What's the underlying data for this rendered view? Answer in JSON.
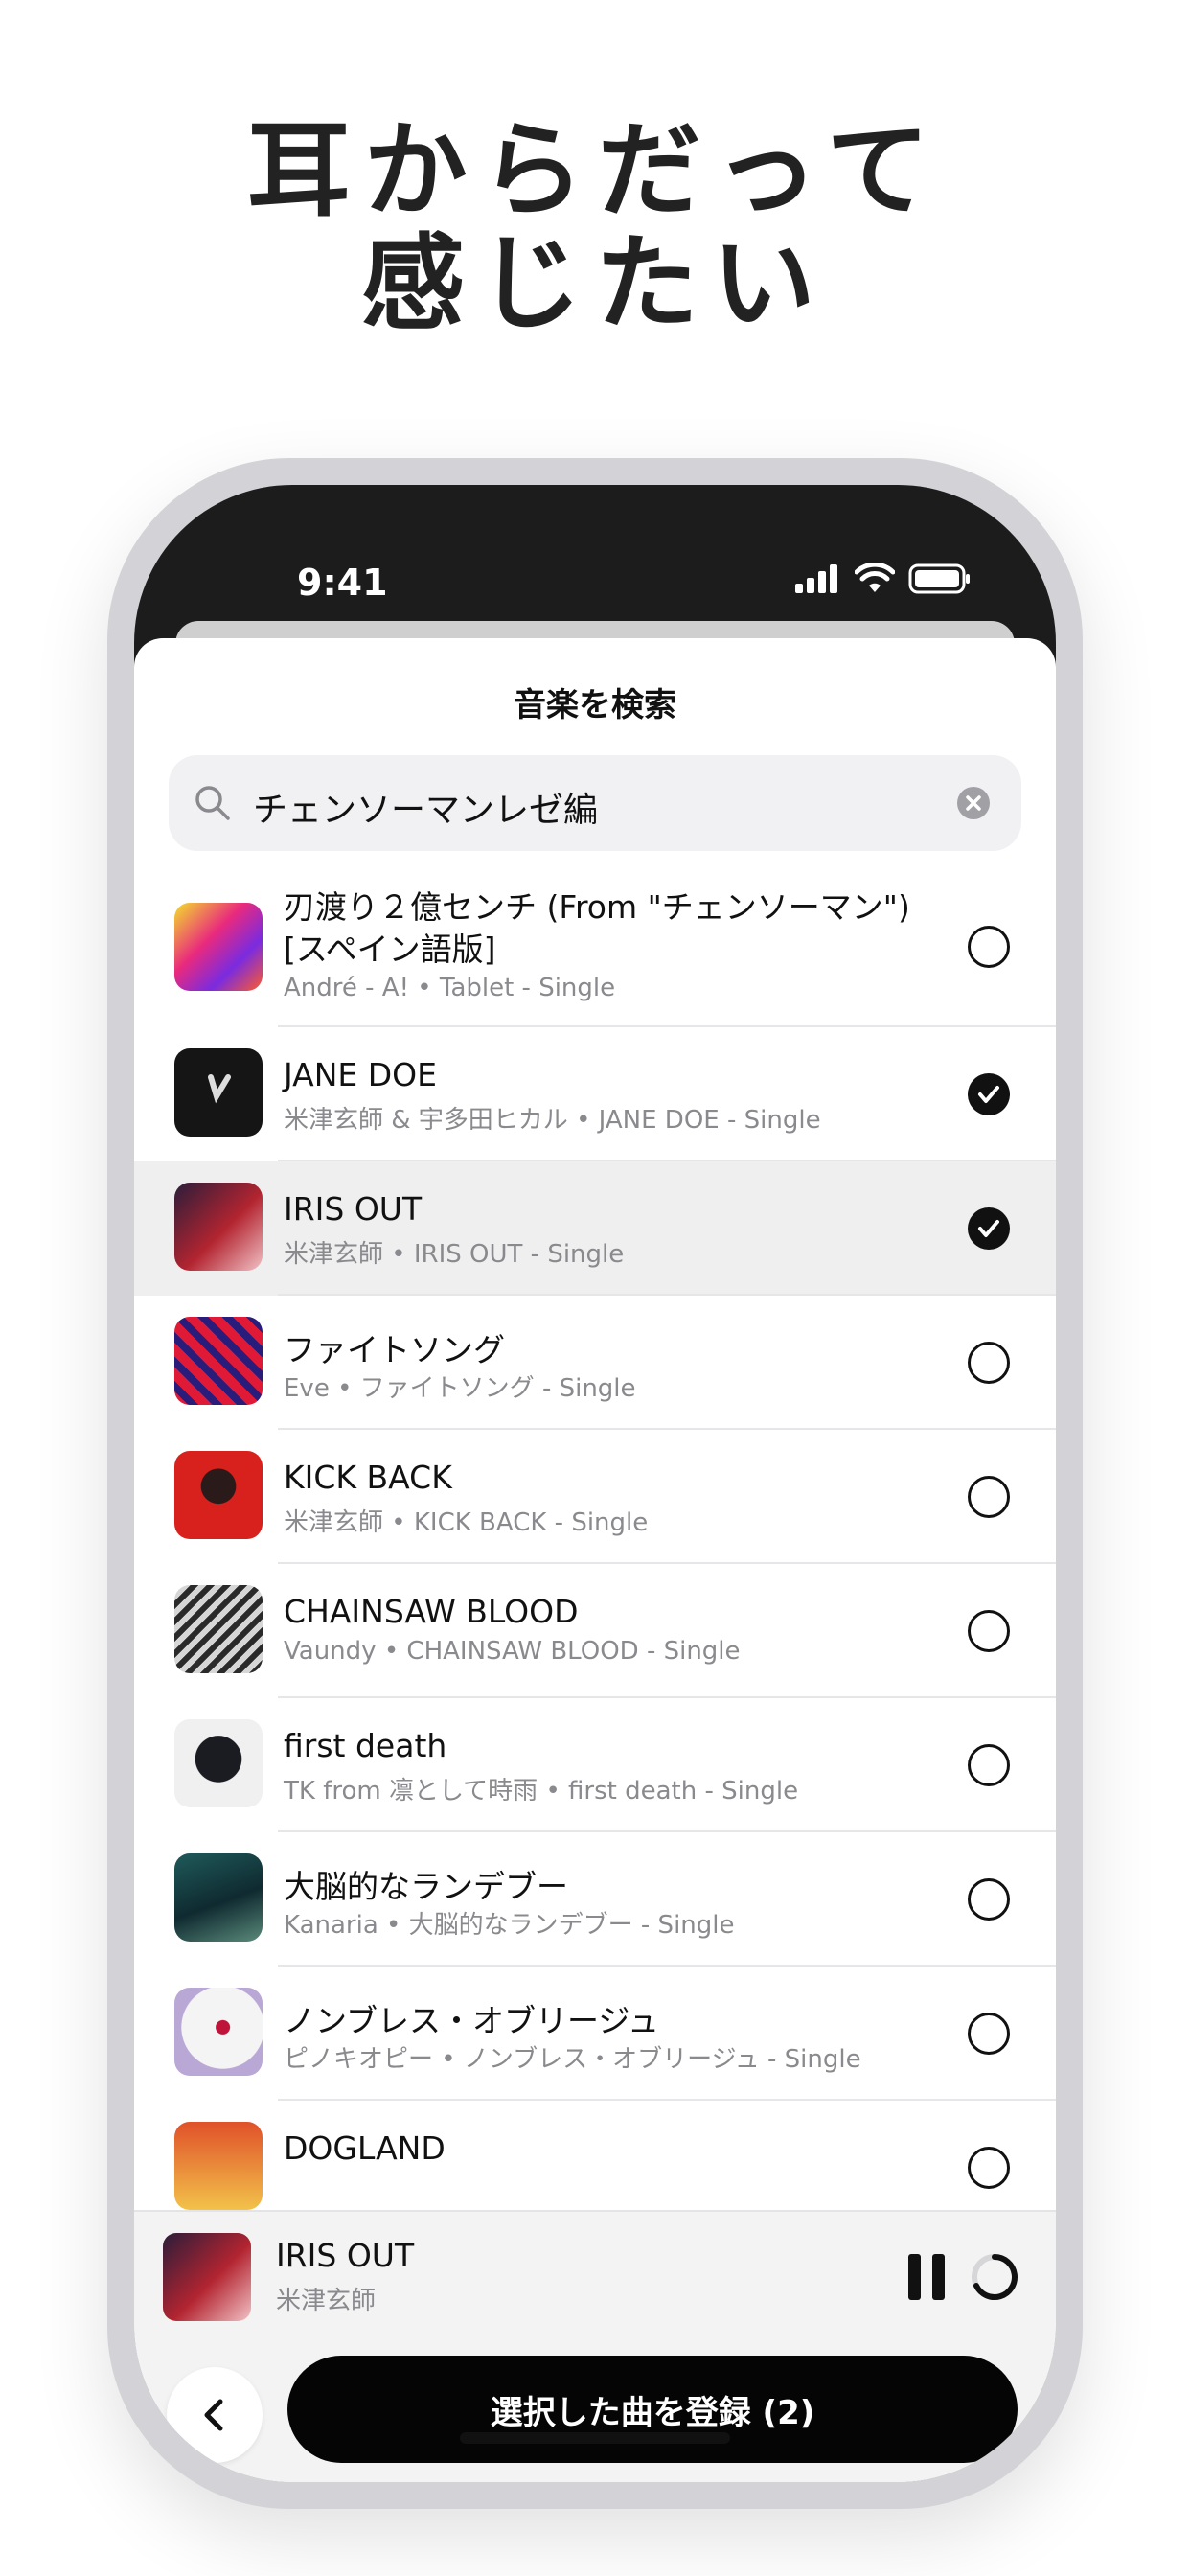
{
  "headline": {
    "line1": "耳からだって",
    "line2": "感じたい"
  },
  "status_bar": {
    "time": "9:41"
  },
  "sheet": {
    "title": "音楽を検索",
    "search": {
      "value": "チェンソーマンレゼ編"
    }
  },
  "tracks": [
    {
      "title_line1": "刃渡り２億センチ (From \"チェンソーマン\")",
      "title_line2": "[スペイン語版]",
      "subtitle": "André - A! • Tablet - Single",
      "selected": false
    },
    {
      "title": "JANE DOE",
      "subtitle": "米津玄師 & 宇多田ヒカル • JANE DOE - Single",
      "selected": true
    },
    {
      "title": "IRIS OUT",
      "subtitle": "米津玄師 • IRIS OUT - Single",
      "selected": true
    },
    {
      "title": "ファイトソング",
      "subtitle": "Eve • ファイトソング - Single",
      "selected": false
    },
    {
      "title": "KICK BACK",
      "subtitle": "米津玄師 • KICK BACK - Single",
      "selected": false
    },
    {
      "title": "CHAINSAW BLOOD",
      "subtitle": "Vaundy • CHAINSAW BLOOD - Single",
      "selected": false
    },
    {
      "title": "first death",
      "subtitle": "TK from 凛として時雨 • first death - Single",
      "selected": false
    },
    {
      "title": "大脳的なランデブー",
      "subtitle": "Kanaria • 大脳的なランデブー - Single",
      "selected": false
    },
    {
      "title": "ノンブレス・オブリージュ",
      "subtitle": "ピノキオピー • ノンブレス・オブリージュ - Single",
      "selected": false
    },
    {
      "title": "DOGLAND",
      "subtitle": "",
      "selected": false
    }
  ],
  "now_playing": {
    "title": "IRIS OUT",
    "artist": "米津玄師"
  },
  "footer": {
    "register_label": "選択した曲を登録 (2)"
  }
}
